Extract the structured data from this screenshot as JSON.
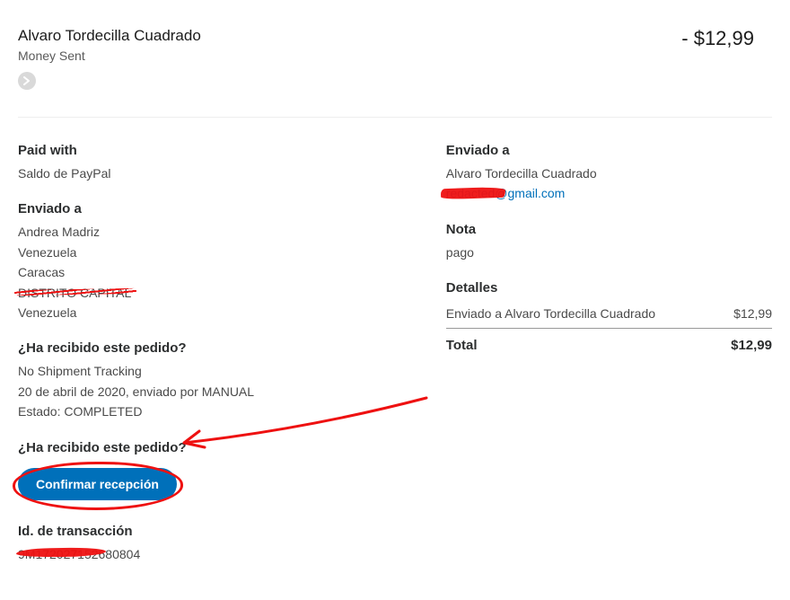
{
  "header": {
    "recipient_name": "Alvaro Tordecilla Cuadrado",
    "status_label": "Money Sent",
    "amount": "- $12,99"
  },
  "left": {
    "paid_with_title": "Paid with",
    "paid_with_value": "Saldo de PayPal",
    "sent_to_title": "Enviado a",
    "address": {
      "name": "Andrea Madriz",
      "country1": "Venezuela",
      "city": "Caracas",
      "district_redacted": "DISTRITO CAPITAL",
      "country2": "Venezuela"
    },
    "received_q1": "¿Ha recibido este pedido?",
    "tracking_none": "No Shipment Tracking",
    "ship_date": "20 de abril de 2020, enviado por MANUAL",
    "ship_status": "Estado: COMPLETED",
    "received_q2": "¿Ha recibido este pedido?",
    "confirm_label": "Confirmar recepción",
    "txn_title": "Id. de transacción",
    "txn_value_redacted": "9M172027152680804"
  },
  "right": {
    "sent_to_title": "Enviado a",
    "sent_to_name": "Alvaro Tordecilla Cuadrado",
    "email_redacted_part": "redacted",
    "email_visible_part": "@gmail.com",
    "note_title": "Nota",
    "note_value": "pago",
    "details_title": "Detalles",
    "details_line": "Enviado a Alvaro Tordecilla Cuadrado",
    "details_amount": "$12,99",
    "total_label": "Total",
    "total_amount": "$12,99"
  }
}
